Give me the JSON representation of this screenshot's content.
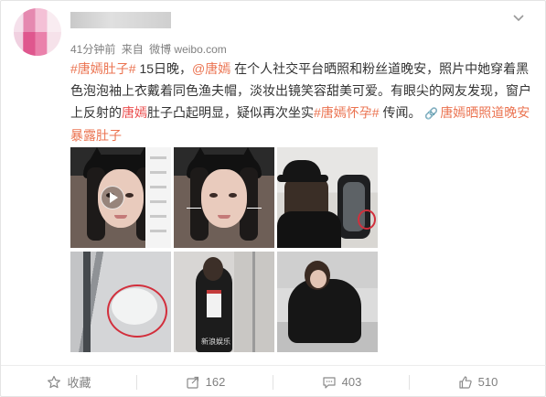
{
  "post": {
    "time": "41分钟前",
    "source_prefix": "来自",
    "source": "微博 weibo.com",
    "text": {
      "hashtag1": "#唐嫣肚子#",
      "part1": " 15日晚，",
      "mention": "@唐嫣",
      "part2": " 在个人社交平台晒照和粉丝道晚安，照片中她穿着黑色泡泡袖上衣戴着同色渔夫帽，淡妆出镜笑容甜美可爱。有眼尖的网友发现，窗户上反射的",
      "highlight": "唐嫣",
      "part3": "肚子凸起明显，疑似再次坐实",
      "hashtag2": "#唐嫣怀孕#",
      "part4": " 传闻。 ",
      "link_text": "唐嫣晒照道晚安暴露肚子",
      "link_icon": "link-icon"
    },
    "images": [
      {
        "kind": "video-selfie",
        "has_play": true
      },
      {
        "kind": "selfie"
      },
      {
        "kind": "bucket-hat",
        "circled": true
      },
      {
        "kind": "window-reflection",
        "circled": true
      },
      {
        "kind": "seated",
        "watermark": "新浪娱乐"
      },
      {
        "kind": "seated-chair"
      }
    ]
  },
  "actions": {
    "favorite": {
      "label": "收藏",
      "icon": "star-icon"
    },
    "repost": {
      "count": "162",
      "icon": "repost-icon"
    },
    "comment": {
      "count": "403",
      "icon": "comment-icon"
    },
    "like": {
      "count": "510",
      "icon": "thumbs-up-icon"
    }
  },
  "colors": {
    "link": "#eb7350",
    "highlight": "#eb4d4d",
    "circle": "#d22f3c",
    "meta_gray": "#808080"
  }
}
